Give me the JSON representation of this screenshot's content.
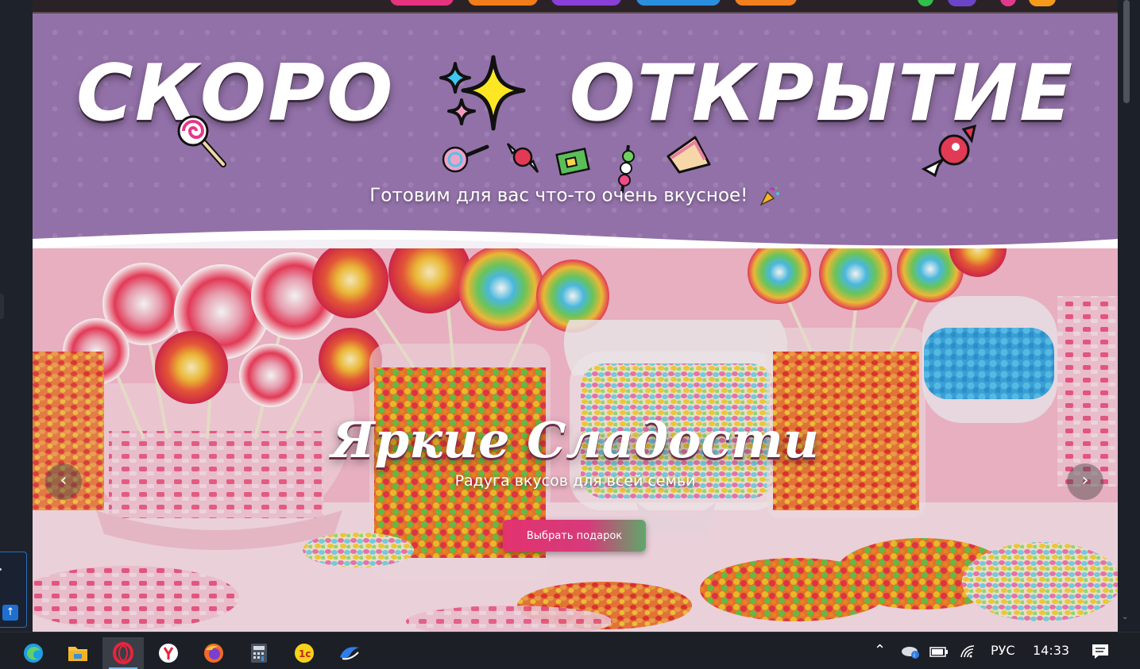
{
  "banner": {
    "headline_left": "СКОРО",
    "headline_right": "ОТКРЫТИЕ",
    "subtitle": "Готовим для вас что-то очень вкусное!"
  },
  "hero": {
    "title": "Яркие Сладости",
    "subtitle": "Радуга вкусов для всей семьи",
    "cta_label": "Выбрать подарок",
    "prev_label": "‹",
    "next_label": "›"
  },
  "colors": {
    "banner_bg": "#9271a8",
    "cta_start": "#e2336f",
    "cta_end": "#5fa86a",
    "nav_pills": [
      "#e5347d",
      "#f07c1a",
      "#8a3fd8",
      "#2b8fe0",
      "#f2801f"
    ],
    "nav_dots": [
      "#2fbf4a",
      "#6b45c9",
      "#e13a8d",
      "#f59a1a"
    ]
  },
  "taskbar": {
    "apps": [
      "edge-icon",
      "file-explorer-icon",
      "opera-icon",
      "yandex-browser-icon",
      "firefox-icon",
      "calculator-icon",
      "1c-icon",
      "cloud-app-icon"
    ],
    "language": "РУС",
    "time": "14:33"
  }
}
